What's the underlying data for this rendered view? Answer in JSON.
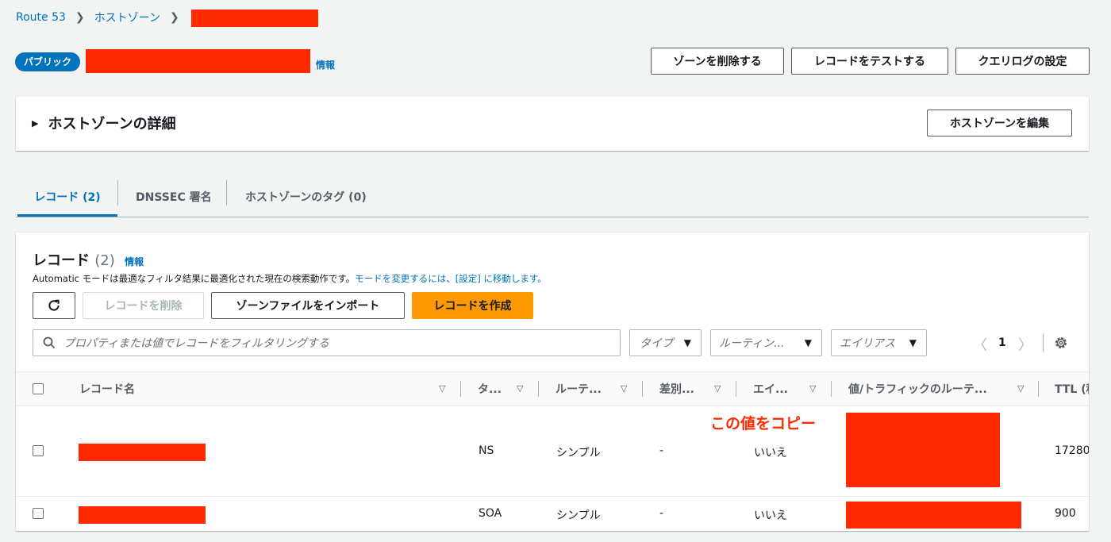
{
  "breadcrumb": {
    "root": "Route 53",
    "zones": "ホストゾーン"
  },
  "header": {
    "badge": "パブリック",
    "info": "情報"
  },
  "actions": {
    "delete_zone": "ゾーンを削除する",
    "test_record": "レコードをテストする",
    "query_log": "クエリログの設定"
  },
  "details": {
    "title": "ホストゾーンの詳細",
    "edit": "ホストゾーンを編集"
  },
  "tabs": [
    {
      "label": "レコード (2)"
    },
    {
      "label": "DNSSEC 署名"
    },
    {
      "label": "ホストゾーンのタグ (0)"
    }
  ],
  "records": {
    "title": "レコード",
    "count": "(2)",
    "info": "情報",
    "desc_prefix": "Automatic モードは最適なフィルタ結果に最適化された現在の検索動作です。",
    "desc_link": "モードを変更するには、[設定] に移動します。",
    "delete": "レコードを削除",
    "import": "ゾーンファイルをインポート",
    "create": "レコードを作成",
    "search_placeholder": "プロパティまたは値でレコードをフィルタリングする",
    "filter_type": "タイプ",
    "filter_routing": "ルーティン...",
    "filter_alias": "エイリアス",
    "page": "1"
  },
  "columns": [
    "レコード名",
    "タ...",
    "ルーテ...",
    "差別...",
    "エイ...",
    "値/トラフィックのルーテ...",
    "TTL (秒"
  ],
  "rows": [
    {
      "type": "NS",
      "routing": "シンプル",
      "diff": "-",
      "alias": "いいえ",
      "ttl": "17280"
    },
    {
      "type": "SOA",
      "routing": "シンプル",
      "diff": "-",
      "alias": "いいえ",
      "ttl": "900"
    }
  ],
  "annotation": "この値をコピー",
  "colors": {
    "link": "#0073bb",
    "primary": "#ff9900",
    "redaction": "#ff2a00"
  }
}
